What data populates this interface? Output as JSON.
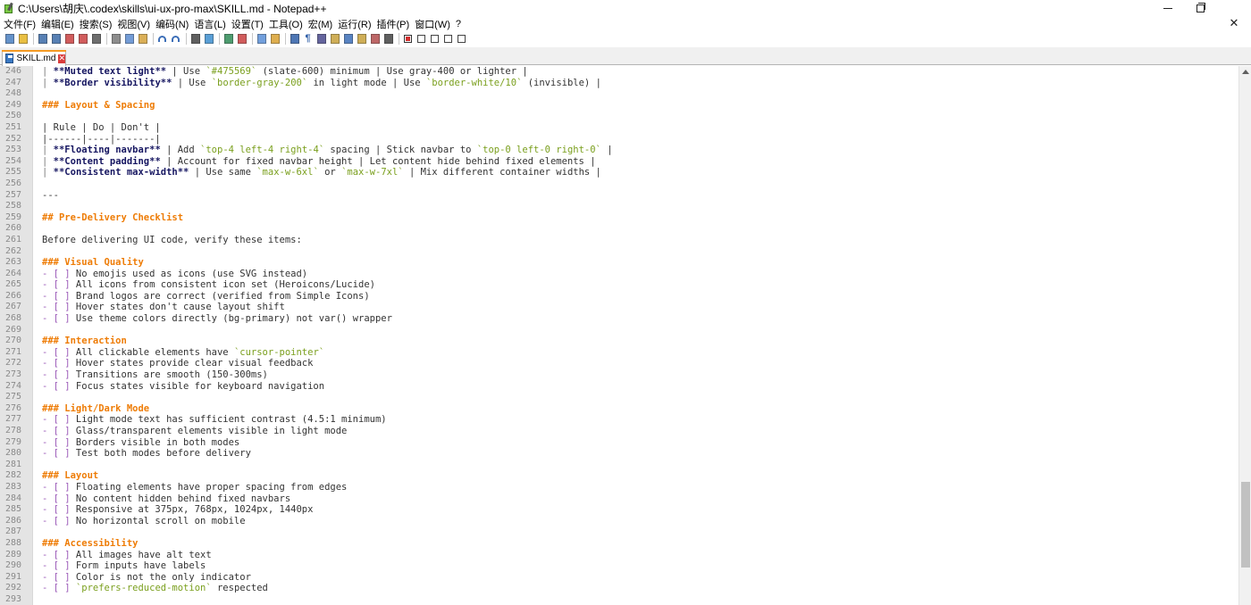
{
  "window": {
    "title": "C:\\Users\\胡庆\\.codex\\skills\\ui-ux-pro-max\\SKILL.md - Notepad++",
    "minimize_glyph": "–",
    "close_glyph": "✕"
  },
  "menu": [
    "文件(F)",
    "编辑(E)",
    "搜索(S)",
    "视图(V)",
    "编码(N)",
    "语言(L)",
    "设置(T)",
    "工具(O)",
    "宏(M)",
    "运行(R)",
    "插件(P)",
    "窗口(W)",
    "?"
  ],
  "toolbar": {
    "icons": [
      "new-file-icon",
      "open-file-icon",
      "save-icon",
      "save-all-icon",
      "close-icon",
      "close-all-icon",
      "print-icon",
      "cut-icon",
      "copy-icon",
      "paste-icon",
      "undo-icon",
      "redo-icon",
      "find-icon",
      "replace-icon",
      "zoom-in-icon",
      "zoom-out-icon",
      "sync-vertical-icon",
      "sync-horizontal-icon",
      "word-wrap-icon",
      "show-all-chars-icon",
      "indent-guide-icon",
      "udl-icon",
      "doc-map-icon",
      "function-list-icon",
      "folder-workspace-icon",
      "monitoring-icon",
      "record-macro-icon",
      "stop-macro-icon",
      "play-macro-icon",
      "run-macro-multiple-icon",
      "save-macro-icon"
    ]
  },
  "tabs": [
    {
      "label": "SKILL.md",
      "active": true
    }
  ],
  "editor": {
    "lines": [
      {
        "n": "246",
        "parts": [
          [
            "pipe",
            "| "
          ],
          [
            "bold",
            "**Muted text light**"
          ],
          [
            "norm",
            " | Use "
          ],
          [
            "code",
            "`#475569`"
          ],
          [
            "norm",
            " (slate-600) minimum | Use gray-400 or lighter |"
          ]
        ]
      },
      {
        "n": "247",
        "parts": [
          [
            "pipe",
            "| "
          ],
          [
            "bold",
            "**Border visibility**"
          ],
          [
            "norm",
            " | Use "
          ],
          [
            "code",
            "`border-gray-200`"
          ],
          [
            "norm",
            " in light mode | Use "
          ],
          [
            "code",
            "`border-white/10`"
          ],
          [
            "norm",
            " (invisible) |"
          ]
        ]
      },
      {
        "n": "248",
        "parts": []
      },
      {
        "n": "249",
        "parts": [
          [
            "head",
            "### Layout & Spacing"
          ]
        ]
      },
      {
        "n": "250",
        "parts": []
      },
      {
        "n": "251",
        "parts": [
          [
            "norm",
            "| Rule | Do | Don't |"
          ]
        ]
      },
      {
        "n": "252",
        "parts": [
          [
            "norm",
            "|------|----|-------|"
          ]
        ]
      },
      {
        "n": "253",
        "parts": [
          [
            "pipe",
            "| "
          ],
          [
            "bold",
            "**Floating navbar**"
          ],
          [
            "norm",
            " | Add "
          ],
          [
            "code",
            "`top-4 left-4 right-4`"
          ],
          [
            "norm",
            " spacing | Stick navbar to "
          ],
          [
            "code",
            "`top-0 left-0 right-0`"
          ],
          [
            "norm",
            " |"
          ]
        ]
      },
      {
        "n": "254",
        "parts": [
          [
            "pipe",
            "| "
          ],
          [
            "bold",
            "**Content padding**"
          ],
          [
            "norm",
            " | Account for fixed navbar height | Let content hide behind fixed elements |"
          ]
        ]
      },
      {
        "n": "255",
        "parts": [
          [
            "pipe",
            "| "
          ],
          [
            "bold",
            "**Consistent max-width**"
          ],
          [
            "norm",
            " | Use same "
          ],
          [
            "code",
            "`max-w-6xl`"
          ],
          [
            "norm",
            " or "
          ],
          [
            "code",
            "`max-w-7xl`"
          ],
          [
            "norm",
            " | Mix different container widths |"
          ]
        ]
      },
      {
        "n": "256",
        "parts": []
      },
      {
        "n": "257",
        "parts": [
          [
            "norm",
            "---"
          ]
        ]
      },
      {
        "n": "258",
        "parts": []
      },
      {
        "n": "259",
        "parts": [
          [
            "head",
            "## Pre-Delivery Checklist"
          ]
        ]
      },
      {
        "n": "260",
        "parts": []
      },
      {
        "n": "261",
        "parts": [
          [
            "norm",
            "Before delivering UI code, verify these items:"
          ]
        ]
      },
      {
        "n": "262",
        "parts": []
      },
      {
        "n": "263",
        "parts": [
          [
            "head",
            "### Visual Quality"
          ]
        ]
      },
      {
        "n": "264",
        "parts": [
          [
            "check",
            "- [ ]"
          ],
          [
            "norm",
            " No emojis used as icons (use SVG instead)"
          ]
        ]
      },
      {
        "n": "265",
        "parts": [
          [
            "check",
            "- [ ]"
          ],
          [
            "norm",
            " All icons from consistent icon set (Heroicons/Lucide)"
          ]
        ]
      },
      {
        "n": "266",
        "parts": [
          [
            "check",
            "- [ ]"
          ],
          [
            "norm",
            " Brand logos are correct (verified from Simple Icons)"
          ]
        ]
      },
      {
        "n": "267",
        "parts": [
          [
            "check",
            "- [ ]"
          ],
          [
            "norm",
            " Hover states don't cause layout shift"
          ]
        ]
      },
      {
        "n": "268",
        "parts": [
          [
            "check",
            "- [ ]"
          ],
          [
            "norm",
            " Use theme colors directly (bg-primary) not var() wrapper"
          ]
        ]
      },
      {
        "n": "269",
        "parts": []
      },
      {
        "n": "270",
        "parts": [
          [
            "head",
            "### Interaction"
          ]
        ]
      },
      {
        "n": "271",
        "parts": [
          [
            "check",
            "- [ ]"
          ],
          [
            "norm",
            " All clickable elements have "
          ],
          [
            "code",
            "`cursor-pointer`"
          ]
        ]
      },
      {
        "n": "272",
        "parts": [
          [
            "check",
            "- [ ]"
          ],
          [
            "norm",
            " Hover states provide clear visual feedback"
          ]
        ]
      },
      {
        "n": "273",
        "parts": [
          [
            "check",
            "- [ ]"
          ],
          [
            "norm",
            " Transitions are smooth (150-300ms)"
          ]
        ]
      },
      {
        "n": "274",
        "parts": [
          [
            "check",
            "- [ ]"
          ],
          [
            "norm",
            " Focus states visible for keyboard navigation"
          ]
        ]
      },
      {
        "n": "275",
        "parts": []
      },
      {
        "n": "276",
        "parts": [
          [
            "head",
            "### Light/Dark Mode"
          ]
        ]
      },
      {
        "n": "277",
        "parts": [
          [
            "check",
            "- [ ]"
          ],
          [
            "norm",
            " Light mode text has sufficient contrast (4.5:1 minimum)"
          ]
        ]
      },
      {
        "n": "278",
        "parts": [
          [
            "check",
            "- [ ]"
          ],
          [
            "norm",
            " Glass/transparent elements visible in light mode"
          ]
        ]
      },
      {
        "n": "279",
        "parts": [
          [
            "check",
            "- [ ]"
          ],
          [
            "norm",
            " Borders visible in both modes"
          ]
        ]
      },
      {
        "n": "280",
        "parts": [
          [
            "check",
            "- [ ]"
          ],
          [
            "norm",
            " Test both modes before delivery"
          ]
        ]
      },
      {
        "n": "281",
        "parts": []
      },
      {
        "n": "282",
        "parts": [
          [
            "head",
            "### Layout"
          ]
        ]
      },
      {
        "n": "283",
        "parts": [
          [
            "check",
            "- [ ]"
          ],
          [
            "norm",
            " Floating elements have proper spacing from edges"
          ]
        ]
      },
      {
        "n": "284",
        "parts": [
          [
            "check",
            "- [ ]"
          ],
          [
            "norm",
            " No content hidden behind fixed navbars"
          ]
        ]
      },
      {
        "n": "285",
        "parts": [
          [
            "check",
            "- [ ]"
          ],
          [
            "norm",
            " Responsive at 375px, 768px, 1024px, 1440px"
          ]
        ]
      },
      {
        "n": "286",
        "parts": [
          [
            "check",
            "- [ ]"
          ],
          [
            "norm",
            " No horizontal scroll on mobile"
          ]
        ]
      },
      {
        "n": "287",
        "parts": []
      },
      {
        "n": "288",
        "parts": [
          [
            "head",
            "### Accessibility"
          ]
        ]
      },
      {
        "n": "289",
        "parts": [
          [
            "check",
            "- [ ]"
          ],
          [
            "norm",
            " All images have alt text"
          ]
        ]
      },
      {
        "n": "290",
        "parts": [
          [
            "check",
            "- [ ]"
          ],
          [
            "norm",
            " Form inputs have labels"
          ]
        ]
      },
      {
        "n": "291",
        "parts": [
          [
            "check",
            "- [ ]"
          ],
          [
            "norm",
            " Color is not the only indicator"
          ]
        ]
      },
      {
        "n": "292",
        "parts": [
          [
            "check",
            "- [ ]"
          ],
          [
            "norm",
            " "
          ],
          [
            "code",
            "`prefers-reduced-motion`"
          ],
          [
            "norm",
            " respected"
          ]
        ]
      },
      {
        "n": "293",
        "parts": []
      }
    ]
  },
  "colors": {
    "heading": "#ee7c06",
    "bold": "#151560",
    "inline_code": "#7a9f1d",
    "checkbox": "#9b5ab8",
    "gutter": "#e4e4e4",
    "tab_accent": "#f59a23"
  }
}
